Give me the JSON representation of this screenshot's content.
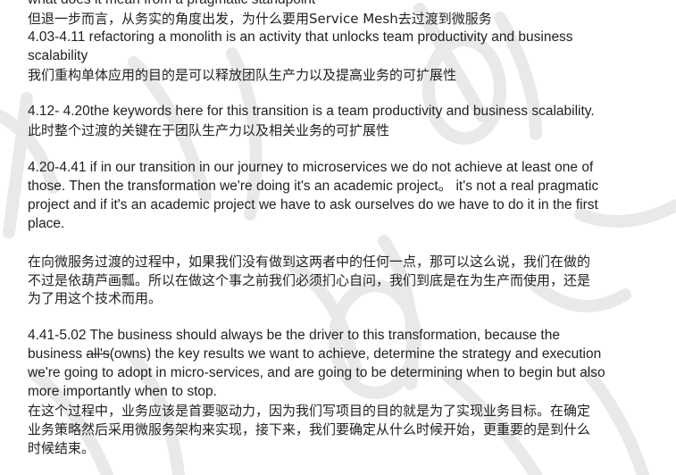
{
  "watermark": {
    "text": "知乎 @知秋 知乎 知秋",
    "color": "#e9e9e9"
  },
  "lines": [
    "what does it mean from a pragmatic standpoint",
    "但退一步而言，从务实的角度出发，为什么要用Service Mesh去过渡到微服务",
    "4.03-4.11 refactoring a monolith is an activity that unlocks team productivity and business",
    "scalability",
    "我们重构单体应用的目的是可以释放团队生产力以及提高业务的可扩展性",
    "4.12- 4.20the keywords here for this transition is a team productivity and  business scalability.",
    "此时整个过渡的关键在于团队生产力以及相关业务的可扩展性",
    "4.20-4.41 if in our transition in our journey to microservices we do not achieve at least one of",
    "those. Then the transformation we're doing it's an academic project。 it's not a real pragmatic",
    "project and if it's an academic project we have to ask ourselves do we have to do it in the first",
    "place.",
    " 在向微服务过渡的过程中，如果我们没有做到这两者中的任何一点，那可以这么说，我们在做的",
    "不过是依葫芦画瓢。所以在做这个事之前我们必须扪心自问，我们到底是在为生产而使用，还是",
    "为了用这个技术而用。",
    "4.41-5.02 The business should always be the driver to this transformation, because the",
    "business ",
    "all's",
    "(owns) the key results we want to achieve, determine the strategy and execution",
    "we're going to adopt in micro-services, and are going to be determining when to begin but also",
    "more importantly when to stop.",
    " 在这个过程中，业务应该是首要驱动力，因为我们写项目的目的就是为了实现业务目标。在确定",
    "业务策略然后采用微服务架构来实现，接下来，我们要确定从什么时候开始，更重要的是到什么",
    "时候结束。"
  ]
}
